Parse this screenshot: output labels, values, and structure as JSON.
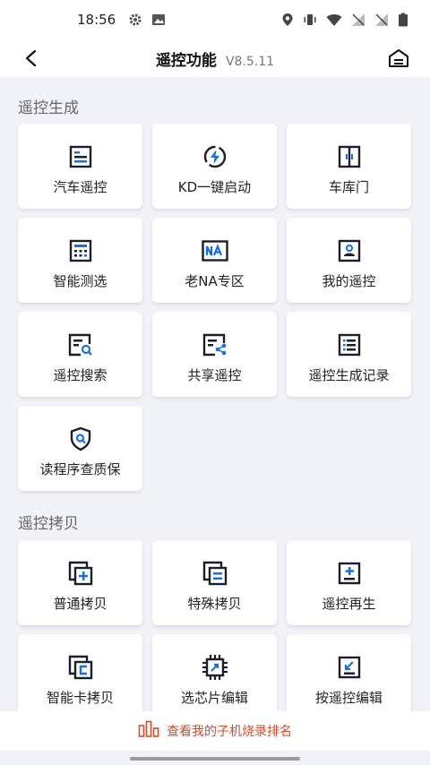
{
  "status_bar": {
    "time": "18:56"
  },
  "header": {
    "title": "遥控功能",
    "version": "V8.5.11"
  },
  "sections": [
    {
      "title": "遥控生成",
      "items": [
        {
          "label": "汽车遥控",
          "icon": "car-remote-icon"
        },
        {
          "label": "KD一键启动",
          "icon": "one-key-start-icon"
        },
        {
          "label": "车库门",
          "icon": "garage-door-icon"
        },
        {
          "label": "智能测选",
          "icon": "smart-test-icon"
        },
        {
          "label": "老NA专区",
          "icon": "na-zone-icon"
        },
        {
          "label": "我的遥控",
          "icon": "my-remote-icon"
        },
        {
          "label": "遥控搜索",
          "icon": "remote-search-icon"
        },
        {
          "label": "共享遥控",
          "icon": "share-remote-icon"
        },
        {
          "label": "遥控生成记录",
          "icon": "generation-record-icon"
        },
        {
          "label": "读程序查质保",
          "icon": "warranty-check-icon"
        }
      ]
    },
    {
      "title": "遥控拷贝",
      "items": [
        {
          "label": "普通拷贝",
          "icon": "normal-copy-icon"
        },
        {
          "label": "特殊拷贝",
          "icon": "special-copy-icon"
        },
        {
          "label": "遥控再生",
          "icon": "remote-regenerate-icon"
        },
        {
          "label": "智能卡拷贝",
          "icon": "smart-card-copy-icon"
        },
        {
          "label": "选芯片编辑",
          "icon": "chip-edit-icon"
        },
        {
          "label": "按遥控编辑",
          "icon": "remote-edit-icon"
        }
      ]
    }
  ],
  "bottom_bar": {
    "text": "查看我的子机烧录排名"
  },
  "colors": {
    "accent": "#1a6fe0",
    "icon_dark": "#1b1f2b",
    "highlight": "#d44a2a"
  }
}
